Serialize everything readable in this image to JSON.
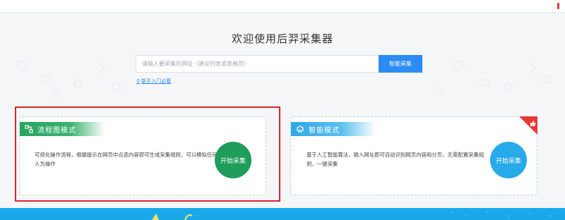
{
  "hero": {
    "title": "欢迎使用后羿采集器",
    "search_placeholder": "请输入要采集的网址（建议列表或表格页）",
    "search_button": "智能采集",
    "guide_link": "新手入门必看"
  },
  "cards": {
    "flow": {
      "title": "流程图模式",
      "description": "可视化操作流程，根据提示在网页中点选内容即可生成采集规则，可以模拟任何人为操作",
      "button": "开始采集",
      "icon": "flowchart-icon",
      "color": "#1f9d5b"
    },
    "smart": {
      "title": "智能模式",
      "description": "基于人工智能算法，输入网址即可自动识别网页内容和分页，无需配置采集规则，一键采集",
      "button": "开始采集",
      "icon": "brain-icon",
      "color": "#27a9ea",
      "badge_icon": "thumbs-up-icon"
    }
  },
  "colors": {
    "accent": "#2c8cf4",
    "highlight": "#d9262c",
    "bottom_band": "#19a9ea"
  }
}
